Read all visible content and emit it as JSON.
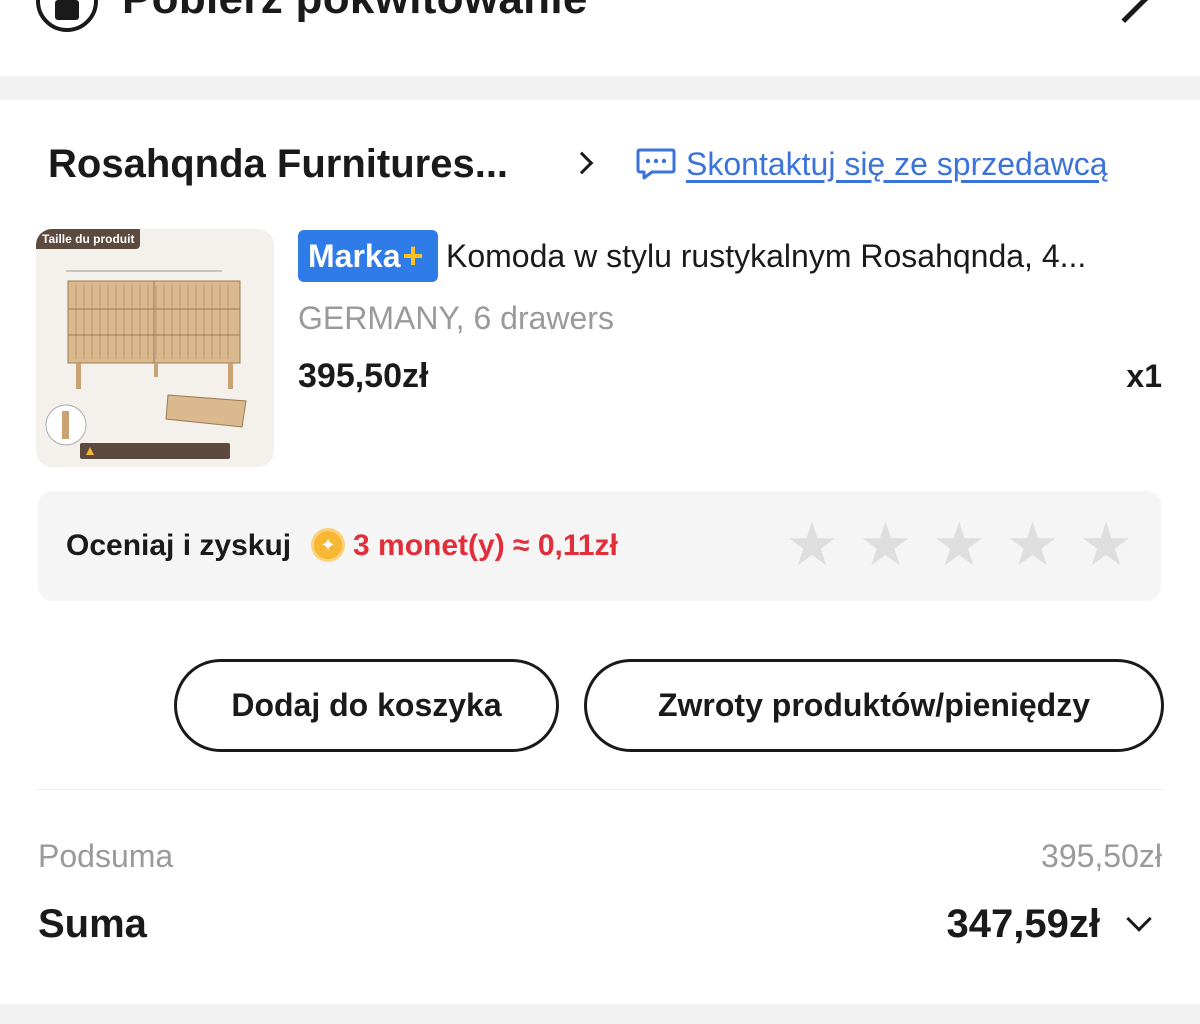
{
  "top": {
    "title": "Pobierz pokwitowanie",
    "icon": "receipt-icon"
  },
  "store": {
    "name": "Rosahqnda Furnitures...",
    "contact_label": "Skontaktuj się ze sprzedawcą",
    "contact_icon": "chat-icon"
  },
  "product": {
    "thumb_tag": "Taille du produit",
    "brand_badge": "Marka",
    "brand_plus": "+",
    "title": "Komoda w stylu rustykalnym Rosahqnda, 4...",
    "variant": "GERMANY, 6 drawers",
    "price": "395,50zł",
    "quantity": "x1"
  },
  "rating": {
    "label": "Oceniaj i zyskuj",
    "coin_reward": "3 monet(y) ≈ 0,11zł",
    "stars_max": 5,
    "stars_selected": 0
  },
  "actions": {
    "add_to_cart": "Dodaj do koszyka",
    "returns": "Zwroty produktów/pieniędzy"
  },
  "totals": {
    "subtotal_label": "Podsuma",
    "subtotal_value": "395,50zł",
    "total_label": "Suma",
    "total_value": "347,59zł"
  },
  "colors": {
    "accent_blue": "#3b73d9",
    "brand_badge_blue": "#2f7be8",
    "brand_plus_yellow": "#ffc21a",
    "coin_red": "#e02e3b",
    "muted_gray": "#9a9a9a"
  }
}
